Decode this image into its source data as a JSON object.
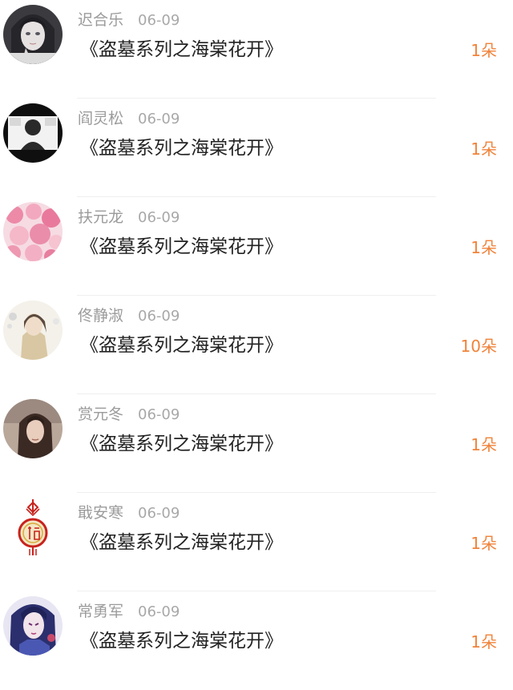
{
  "list": {
    "items": [
      {
        "name": "迟合乐",
        "date": "06-09",
        "title": "《盗墓系列之海棠花开》",
        "amount": "1朵",
        "avatar_icon": "anime-girl-avatar-icon"
      },
      {
        "name": "阎灵松",
        "date": "06-09",
        "title": "《盗墓系列之海棠花开》",
        "amount": "1朵",
        "avatar_icon": "boy-photo-avatar-icon"
      },
      {
        "name": "扶元龙",
        "date": "06-09",
        "title": "《盗墓系列之海棠花开》",
        "amount": "1朵",
        "avatar_icon": "pink-flowers-avatar-icon"
      },
      {
        "name": "佟静淑",
        "date": "06-09",
        "title": "《盗墓系列之海棠花开》",
        "amount": "10朵",
        "avatar_icon": "illustrated-girl-avatar-icon"
      },
      {
        "name": "赏元冬",
        "date": "06-09",
        "title": "《盗墓系列之海棠花开》",
        "amount": "1朵",
        "avatar_icon": "woman-portrait-avatar-icon"
      },
      {
        "name": "戢安寒",
        "date": "06-09",
        "title": "《盗墓系列之海棠花开》",
        "amount": "1朵",
        "avatar_icon": "fu-knot-avatar-icon"
      },
      {
        "name": "常勇军",
        "date": "06-09",
        "title": "《盗墓系列之海棠花开》",
        "amount": "1朵",
        "avatar_icon": "blue-anime-avatar-icon"
      }
    ]
  },
  "colors": {
    "accent": "#f0833a",
    "name_text": "#9b9b9b",
    "title_text": "#222222",
    "divider": "#efefef"
  }
}
